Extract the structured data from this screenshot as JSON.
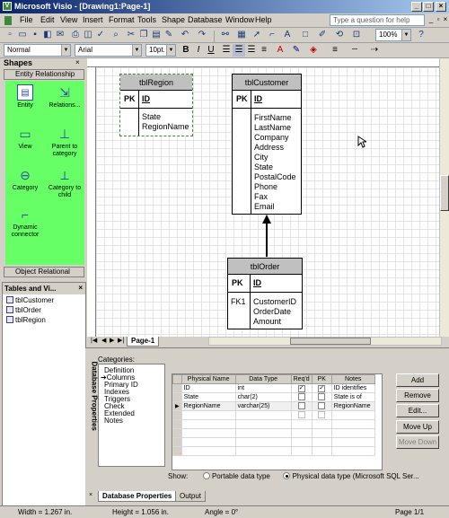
{
  "window": {
    "title": "Microsoft Visio - [Drawing1:Page-1]",
    "controls": [
      "_",
      "□",
      "×"
    ]
  },
  "menu": {
    "items": [
      "File",
      "Edit",
      "View",
      "Insert",
      "Format",
      "Tools",
      "Shape",
      "Database",
      "Window",
      "Help"
    ],
    "help_placeholder": "Type a question for help"
  },
  "toolbar": {
    "style": "Normal",
    "font": "Arial",
    "size": "10pt.",
    "zoom": "100%"
  },
  "shapes_pane": {
    "title": "Shapes",
    "stencil": "Entity Relationship",
    "items": [
      {
        "label": "Entity",
        "icon": "entity-icon"
      },
      {
        "label": "Relations...",
        "icon": "relationship-icon"
      },
      {
        "label": "View",
        "icon": "view-icon"
      },
      {
        "label": "Parent to category",
        "icon": "parent-category-icon"
      },
      {
        "label": "Category",
        "icon": "category-icon"
      },
      {
        "label": "Category to child",
        "icon": "category-child-icon"
      },
      {
        "label": "Dynamic connector",
        "icon": "connector-icon"
      }
    ],
    "bottom_stencil": "Object Relational"
  },
  "tables_pane": {
    "title": "Tables and Vi...",
    "items": [
      "tblCustomer",
      "tblOrder",
      "tblRegion"
    ]
  },
  "diagram": {
    "entities": [
      {
        "name": "tblRegion",
        "pk_label": "PK",
        "pk": "ID",
        "attrs": [
          "State",
          "RegionName"
        ]
      },
      {
        "name": "tblCustomer",
        "pk_label": "PK",
        "pk": "ID",
        "attrs": [
          "FirstName",
          "LastName",
          "Company",
          "Address",
          "City",
          "State",
          "PostalCode",
          "Phone",
          "Fax",
          "Email"
        ]
      },
      {
        "name": "tblOrder",
        "pk_label": "PK",
        "pk": "ID",
        "fk_label": "FK1",
        "attrs": [
          "CustomerID",
          "OrderDate",
          "Amount"
        ]
      }
    ]
  },
  "page_tab": "Page-1",
  "db_properties": {
    "side_title": "Database Properties",
    "categories_label": "Categories:",
    "categories": [
      "Definition",
      "Columns",
      "Primary ID",
      "Indexes",
      "Triggers",
      "Check",
      "Extended",
      "Notes"
    ],
    "columns": [
      "Physical Name",
      "Data Type",
      "Req'd",
      "PK",
      "Notes"
    ],
    "rows": [
      {
        "name": "ID",
        "type": "int",
        "req": true,
        "pk": true,
        "notes": "ID identifies"
      },
      {
        "name": "State",
        "type": "char(2)",
        "req": false,
        "pk": false,
        "notes": "State is of"
      },
      {
        "name": "RegionName",
        "type": "varchar(25)",
        "req": false,
        "pk": false,
        "notes": "RegionName"
      }
    ],
    "buttons": [
      "Add",
      "Remove",
      "Edit...",
      "Move Up",
      "Move Down"
    ],
    "show_label": "Show:",
    "portable": "Portable data type",
    "physical": "Physical data type",
    "physical_note": "(Microsoft SQL Ser..."
  },
  "bottom_tabs": [
    "Database Properties",
    "Output"
  ],
  "status": {
    "width": "Width = 1.267 in.",
    "height": "Height = 1.056 in.",
    "angle": "Angle = 0°",
    "page": "Page 1/1"
  }
}
